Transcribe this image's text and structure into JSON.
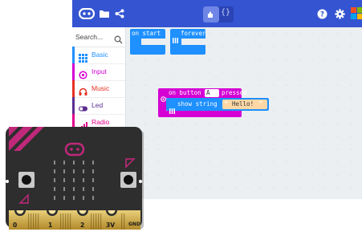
{
  "toolbar": {
    "logo_icon": "microbit-logo-icon",
    "folder_icon": "folder-icon",
    "share_icon": "share-icon",
    "blocks_mode_icon": "puzzle-icon",
    "js_mode_label": "{}",
    "help_icon": "help-icon",
    "settings_icon": "gear-icon",
    "brand_icon": "microsoft-logo-icon"
  },
  "sidebar": {
    "search_placeholder": "Search...",
    "categories": [
      {
        "label": "Basic",
        "color": "#1e90ff",
        "icon": "grid-icon"
      },
      {
        "label": "Input",
        "color": "#d400d4",
        "icon": "target-icon"
      },
      {
        "label": "Music",
        "color": "#e63022",
        "icon": "headphones-icon"
      },
      {
        "label": "Led",
        "color": "#5c2d91",
        "icon": "toggle-icon"
      },
      {
        "label": "Radio",
        "color": "#e3008c",
        "icon": "signal-bars-icon"
      }
    ]
  },
  "workspace": {
    "on_start": {
      "label": "on start",
      "color": "#1e90ff"
    },
    "forever": {
      "label": "forever",
      "color": "#1e90ff"
    },
    "on_button": {
      "prefix": "on button",
      "button": "A",
      "suffix": "pressed",
      "color": "#d400d4"
    },
    "show_string": {
      "label": "show string",
      "value": "Hello!",
      "color": "#1e90ff",
      "value_bg": "#fdd8a6"
    }
  },
  "microbit": {
    "board_color": "#2e2e2e",
    "pins": [
      "0",
      "1",
      "2",
      "3V",
      "GND"
    ]
  }
}
